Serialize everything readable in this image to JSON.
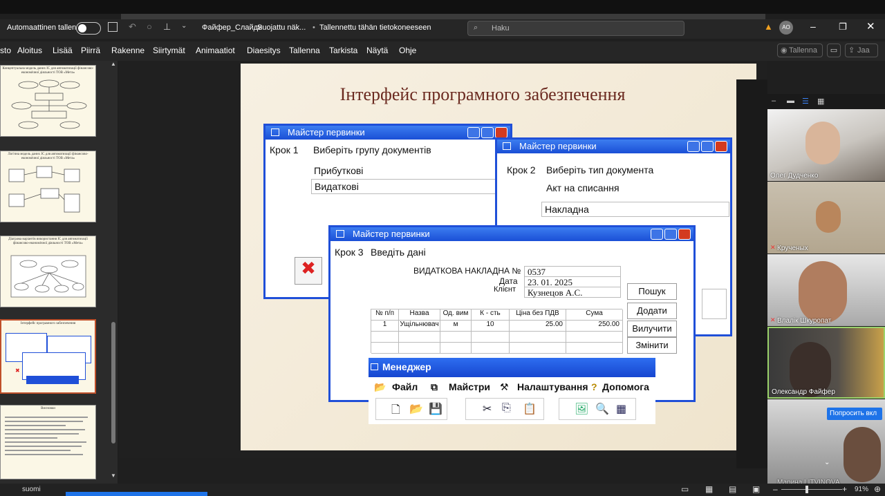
{
  "titlebar": {
    "autosave_label": "Automaattinen tallennus",
    "file_title": "Файфер_Слайди",
    "protection": "Suojattu näk...",
    "saved_status": "Tallennettu tähän tietokoneeseen",
    "search_placeholder": "Haku",
    "user_initials": "AO"
  },
  "menu": [
    "sto",
    "Aloitus",
    "Lisää",
    "Piirrä",
    "Rakenne",
    "Siirtymät",
    "Animaatiot",
    "Diaesitys",
    "Tallenna",
    "Tarkista",
    "Näytä",
    "Ohje"
  ],
  "record_button": "Tallenna",
  "share_button": "Jaa",
  "thumbnails": [
    {
      "title": "Концептуальна модель даних ІС для автоматизації фінансово-економічної діяльності ТОВ «Мета»"
    },
    {
      "title": "Логічна модель даних ІС для автоматизації фінансово-економічної діяльності ТОВ «Мета»"
    },
    {
      "title": "Діаграма варіантів використання ІС для автоматизації фінансово-економічної діяльності ТОВ «Мета»"
    },
    {
      "title": "Інтерфейс програмного забезпечення"
    },
    {
      "title": "Висновки"
    }
  ],
  "slide": {
    "title": "Інтерфейс програмного забезпечення",
    "win1": {
      "caption": "Майстер первинки",
      "step": "Крок 1",
      "prompt": "Виберіть групу документів",
      "option1": "Прибуткові",
      "option2": "Видаткові"
    },
    "win2": {
      "caption": "Майстер первинки",
      "step": "Крок 2",
      "prompt": "Виберіть тип документа",
      "option1": "Акт на списання",
      "option2": "Накладна"
    },
    "win3": {
      "caption": "Майстер первинки",
      "step": "Крок 3",
      "prompt": "Введіть дані",
      "doc_label": "ВИДАТКОВА НАКЛАДНА №",
      "doc_number": "0537",
      "date_label": "Дата",
      "date_value": "23. 01. 2025",
      "client_label": "Клієнт",
      "client_value": "Кузнецов А.С.",
      "btn_search": "Пошук",
      "btn_add": "Додати",
      "btn_delete": "Вилучити",
      "btn_change": "Змінити",
      "table_headers": [
        "№ п/п",
        "Назва",
        "Од. вим",
        "К - сть",
        "Ціна без ПДВ",
        "Сума"
      ],
      "table_rows": [
        [
          "1",
          "Ущільнювач",
          "м",
          "10",
          "25.00",
          "250.00"
        ]
      ]
    },
    "manager": {
      "caption": "Менеджер",
      "menu": [
        "Файл",
        "Майстри",
        "Налаштування",
        "Допомога"
      ]
    }
  },
  "participants": [
    {
      "name": "Олег Дудченко"
    },
    {
      "name": "Крученых"
    },
    {
      "name": "Влалік Шкуропат"
    },
    {
      "name": "Олександр Файфер"
    },
    {
      "name": "Марина LITVINOVA"
    }
  ],
  "raise_hand_label": "Попросить вкл",
  "status": {
    "language": "suomi",
    "zoom": "91%"
  }
}
